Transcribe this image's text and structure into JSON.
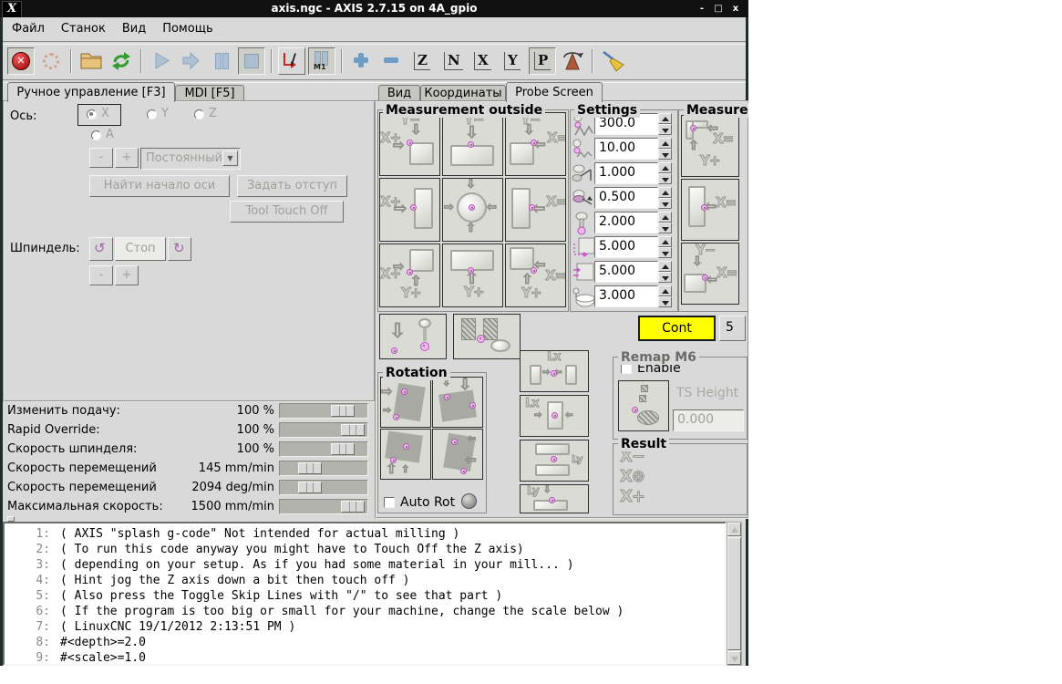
{
  "window": {
    "title": "axis.ngc - AXIS 2.7.15 on 4A_gpio",
    "icon": "x11-logo",
    "controls": {
      "minimize": "-",
      "maximize": "□",
      "close": "x"
    }
  },
  "menubar": {
    "items": [
      "Файл",
      "Станок",
      "Вид",
      "Помощь"
    ]
  },
  "toolbar": {
    "buttons": [
      {
        "name": "estop-button",
        "icon": "estop",
        "state": "sunken"
      },
      {
        "name": "machine-power-button",
        "icon": "power",
        "state": "flat"
      },
      {
        "sep": true
      },
      {
        "name": "open-file-button",
        "icon": "open",
        "state": "flat"
      },
      {
        "name": "reload-file-button",
        "icon": "reload",
        "state": "flat"
      },
      {
        "sep": true
      },
      {
        "name": "run-program-button",
        "icon": "run",
        "state": "flat"
      },
      {
        "name": "step-button",
        "icon": "step",
        "state": "flat"
      },
      {
        "name": "pause-button",
        "icon": "pause",
        "state": "flat"
      },
      {
        "name": "stop-program-button",
        "icon": "stop",
        "state": "sunken"
      },
      {
        "sep": true
      },
      {
        "name": "toggle-skip-lines-button",
        "icon": "skip",
        "state": "raised"
      },
      {
        "name": "optional-stop-button",
        "icon": "m1",
        "glyph": "M1",
        "state": "sunken"
      },
      {
        "sep": true
      },
      {
        "name": "zoom-in-button",
        "icon": "zoomin",
        "state": "flat"
      },
      {
        "name": "zoom-out-button",
        "icon": "zoomout",
        "state": "flat"
      },
      {
        "name": "view-top-button",
        "icon": "view",
        "glyph": "Z",
        "state": "flat"
      },
      {
        "name": "view-rotated-top-button",
        "icon": "view",
        "glyph": "N",
        "state": "flat"
      },
      {
        "name": "view-front-button",
        "icon": "view",
        "glyph": "X",
        "state": "flat"
      },
      {
        "name": "view-side-button",
        "icon": "view",
        "glyph": "Y",
        "state": "flat"
      },
      {
        "name": "view-perspective-button",
        "icon": "view",
        "glyph": "P",
        "state": "sunken"
      },
      {
        "name": "rotate-view-button",
        "icon": "rotate",
        "state": "flat"
      },
      {
        "sep": true
      },
      {
        "name": "clear-plot-button",
        "icon": "broom",
        "state": "flat"
      }
    ]
  },
  "left_panel": {
    "tabs": [
      {
        "label": "Ручное управление [F3]",
        "active": true
      },
      {
        "label": "MDI [F5]",
        "active": false
      }
    ],
    "manual": {
      "axis_label": "Ось:",
      "axes": [
        {
          "label": "X",
          "selected": true
        },
        {
          "label": "Y",
          "selected": false
        },
        {
          "label": "Z",
          "selected": false
        },
        {
          "label": "A",
          "selected": false
        }
      ],
      "jog_minus": "-",
      "jog_plus": "+",
      "jog_mode": "Постоянный",
      "home_axis": "Найти начало оси",
      "set_offset": "Задать отступ",
      "tool_touch_off": "Tool Touch Off",
      "spindle_label": "Шпиндель:",
      "spindle_stop": "Стоп",
      "spindle_minus": "-",
      "spindle_plus": "+"
    },
    "overrides": [
      {
        "label": "Изменить подачу:",
        "value": "100",
        "unit": "%",
        "pos": 80
      },
      {
        "label": "Rapid Override:",
        "value": "100",
        "unit": "%",
        "pos": 96
      },
      {
        "label": "Скорость шпинделя:",
        "value": "100",
        "unit": "%",
        "pos": 80
      },
      {
        "label": "Скорость перемещений",
        "value": "145",
        "unit": "mm/min",
        "pos": 27
      },
      {
        "label": "Скорость перемещений",
        "value": "2094",
        "unit": "deg/min",
        "pos": 27
      },
      {
        "label": "Максимальная скорость:",
        "value": "1500",
        "unit": "mm/min",
        "pos": 96
      }
    ]
  },
  "right_panel": {
    "tabs": [
      {
        "label": "Вид",
        "active": false
      },
      {
        "label": "Координаты",
        "active": false
      },
      {
        "label": "Probe Screen",
        "active": true
      }
    ],
    "measurement_outside": {
      "title": "Measurement outside",
      "cells": [
        {
          "name": "probe-outside-corner-xplus-yminus",
          "letters": [
            "Y−",
            "X+"
          ]
        },
        {
          "name": "probe-outside-edge-yminus",
          "letters": [
            "Y−"
          ]
        },
        {
          "name": "probe-outside-corner-xminus-yminus",
          "letters": [
            "Y−",
            "X="
          ]
        },
        {
          "name": "probe-outside-edge-xplus",
          "letters": [
            "X+"
          ]
        },
        {
          "name": "probe-outside-center-hole",
          "letters": []
        },
        {
          "name": "probe-outside-edge-xminus",
          "letters": [
            "X="
          ]
        },
        {
          "name": "probe-outside-corner-xplus-yplus",
          "letters": [
            "X+",
            "Y+"
          ]
        },
        {
          "name": "probe-outside-edge-yplus",
          "letters": [
            "Y+"
          ]
        },
        {
          "name": "probe-outside-corner-xminus-yplus",
          "letters": [
            "X=",
            "Y+"
          ]
        }
      ]
    },
    "settings": {
      "title": "Settings",
      "rows": [
        {
          "icon": "probe-rapid-speed-icon",
          "value": "300.0"
        },
        {
          "icon": "probe-slow-speed-icon",
          "value": "10.00"
        },
        {
          "icon": "probe-tip-angle-icon",
          "value": "1.000"
        },
        {
          "icon": "probe-xy-clearance-icon",
          "value": "0.500"
        },
        {
          "icon": "probe-z-clearance-icon",
          "value": "2.000"
        },
        {
          "icon": "edge-length-icon",
          "value": "5.000"
        },
        {
          "icon": "travel-distance-icon",
          "value": "5.000"
        },
        {
          "icon": "tool-z-height-icon",
          "value": "3.000"
        }
      ]
    },
    "measurement_inside": {
      "title": "Measurement inside",
      "cells": [
        {
          "name": "probe-inside-corner-xminus-yplus",
          "letters": [
            "X=",
            "Y+"
          ]
        },
        {
          "name": "probe-inside-edge-xminus",
          "letters": [
            "X="
          ]
        },
        {
          "name": "probe-inside-corner-xminus-yminus",
          "letters": [
            "Y−",
            "X="
          ]
        }
      ]
    },
    "utility_buttons": [
      {
        "name": "probe-down-button"
      },
      {
        "name": "tool-length-measure-button"
      }
    ],
    "jog_mode_combo": {
      "value": "Cont",
      "highlight": "#ffff00"
    },
    "edge_spin": {
      "value": "5"
    },
    "rotation": {
      "title": "Rotation",
      "auto_rot": "Auto Rot",
      "cells": [
        {
          "name": "rotate-front-edge-button"
        },
        {
          "name": "rotate-back-edge-button"
        },
        {
          "name": "rotate-left-edge-button"
        },
        {
          "name": "rotate-right-edge-button"
        }
      ]
    },
    "length_buttons": [
      {
        "name": "length-x-outside-button",
        "label": "Lx"
      },
      {
        "name": "length-x-inside-button",
        "label": "Lx"
      },
      {
        "name": "length-y-outside-button",
        "label": "Ly"
      },
      {
        "name": "length-y-inside-button",
        "label": "Ly"
      }
    ],
    "remap_m6": {
      "title": "Remap M6",
      "enable": "Enable",
      "ts_height_label": "TS Height",
      "ts_height_value": "0.000"
    },
    "result": {
      "title": "Result",
      "items": [
        "X−",
        "X⊕",
        "X+"
      ]
    }
  },
  "gcode": {
    "lines": [
      {
        "num": "1:",
        "text": "( AXIS \"splash g-code\" Not intended for actual milling )"
      },
      {
        "num": "2:",
        "text": "( To run this code anyway you might have to Touch Off the Z axis)"
      },
      {
        "num": "3:",
        "text": "( depending on your setup. As if you had some material in your mill... )"
      },
      {
        "num": "4:",
        "text": "( Hint jog the Z axis down a bit then touch off )"
      },
      {
        "num": "5:",
        "text": "( Also press the Toggle Skip Lines with \"/\" to see that part )"
      },
      {
        "num": "6:",
        "text": "( If the program is too big or small for your machine, change the scale below )"
      },
      {
        "num": "7:",
        "text": "( LinuxCNC 19/1/2012 2:13:51 PM )"
      },
      {
        "num": "8:",
        "text": "#<depth>=2.0"
      },
      {
        "num": "9:",
        "text": "#<scale>=1.0"
      }
    ]
  }
}
